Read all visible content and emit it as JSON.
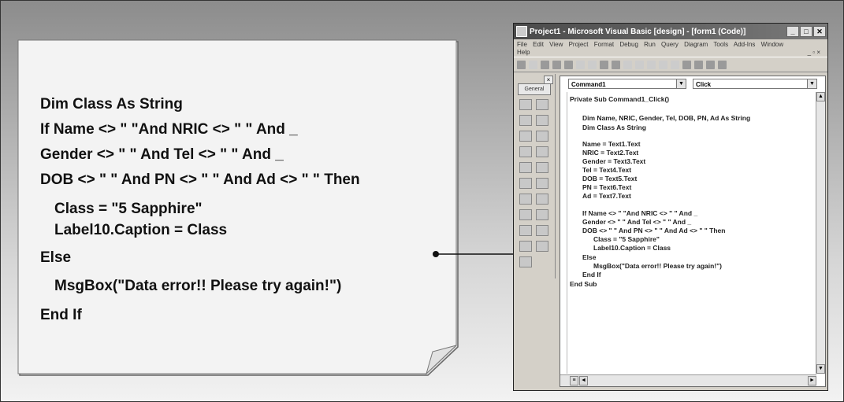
{
  "note": {
    "lines": [
      "Dim Class As String",
      "If Name <> \" \"And NRIC <> \" \" And _",
      "Gender <> \" \" And Tel <> \" \" And _",
      "DOB <> \" \" And PN <> \" \"  And Ad <> \" \" Then",
      "Class = \"5 Sapphire\"",
      "Label10.Caption = Class",
      "Else",
      "MsgBox(\"Data error!! Please try again!\")",
      "End If"
    ]
  },
  "vb": {
    "title": "Project1 - Microsoft Visual Basic [design] - [form1 (Code)]",
    "menu": [
      "File",
      "Edit",
      "View",
      "Project",
      "Format",
      "Debug",
      "Run",
      "Query",
      "Diagram",
      "Tools",
      "Add-Ins",
      "Window",
      "Help"
    ],
    "toolbox_tab": "General",
    "object_combo": "Command1",
    "proc_combo": "Click",
    "code_lines": [
      "Private Sub Command1_Click()",
      "Dim Name, NRIC, Gender, Tel, DOB, PN, Ad As String",
      "Dim Class As String",
      "Name = Text1.Text",
      "NRIC = Text2.Text",
      "Gender = Text3.Text",
      "Tel = Text4.Text",
      "DOB = Text5.Text",
      "PN = Text6.Text",
      "Ad = Text7.Text",
      "If Name <> \" \"And NRIC <> \" \" And _",
      "Gender <> \" \" And Tel <> \" \" And _",
      "DOB <> \" \" And PN <> \" \" And Ad <> \" \" Then",
      "Class = \"5 Sapphire\"",
      "Label10.Caption = Class",
      "Else",
      "MsgBox(\"Data error!! Please try again!\")",
      "End If",
      "End Sub"
    ]
  }
}
